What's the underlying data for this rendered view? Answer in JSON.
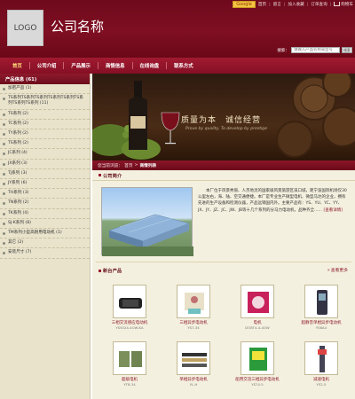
{
  "header": {
    "logo_text": "LOGO",
    "company_name": "公司名称",
    "google_badge": "Google",
    "top_links": [
      "首页",
      "留言",
      "加入收藏",
      "订单查询",
      "购物车"
    ],
    "search": {
      "label": "搜索：",
      "placeholder": "请输入产品名称或型号",
      "button": "搜索"
    }
  },
  "nav": {
    "items": [
      "首页",
      "公司介绍",
      "产品展示",
      "商情信息",
      "在线询盘",
      "联系方式"
    ]
  },
  "sidebar": {
    "title": "产品信息 (61)",
    "items": [
      "加密产品 (1)",
      "TS系列TS系列TS系列TS系列TS系列TS系列TS系列TS系列 (11)",
      "TS系列 (2)",
      "TC系列 (2)",
      "TY系列 (2)",
      "TS系列 (2)",
      "JC系列 (4)",
      "JX系列 (3)",
      "TJ系列 (3)",
      "JY系列 (6)",
      "TH系列 (3)",
      "TN系列 (2)",
      "TK系列 (4)",
      "SJ-K系列 (8)",
      "TM系列小型高耐用电动机 (1)",
      "其它 (2)",
      "安装尺寸 (7)"
    ]
  },
  "banner": {
    "slogan": "质量为本　诚信经营",
    "sub": "Prove by quality, To develop by prestige"
  },
  "breadcrumb": {
    "prefix": "您当前浏览：",
    "home": "首页",
    "sep": ">",
    "current": "商情列表"
  },
  "intro": {
    "title": "公司简介",
    "text": "本厂位于风景秀丽、人杰地灵的国家级风景旅游区溪口城，距宁波国际机场仅30公里左右，海、陆、空交通便捷。本厂是专业生产微型电机、微型马达的企业，拥有先进的生产设备和检测仪器，产品远销国内外。主要产品有：YS、YU、YC、YY、JX、JY、JZ、JC、JW、JB等十几个系列的分马力电动机，品种齐全……",
    "more": "[查看详情]"
  },
  "products_section": {
    "title": "新台产品",
    "more": "查看更多"
  },
  "products": [
    {
      "name": "三相交流感应电动机",
      "model": "YS5024-4OW-KA"
    },
    {
      "name": "三相异步电动机",
      "model": "YS7-34"
    },
    {
      "name": "电机",
      "model": "DO8T4-4-4OW"
    },
    {
      "name": "超静音单相异步电动机",
      "model": "YS6A4"
    },
    {
      "name": "超级电机",
      "model": "YT8-34"
    },
    {
      "name": "单相异步电动机",
      "model": "YL-H"
    },
    {
      "name": "船用交流三相异步电动机",
      "model": "YS74-5"
    },
    {
      "name": "减速电机",
      "model": "YS2-5"
    }
  ],
  "colors": {
    "header_bg": "#7f0f22",
    "nav_bg": "#a11a30",
    "sidebar_bg": "#e9e3cc",
    "main_bg": "#f4f0df",
    "link": "#8a1628"
  },
  "icons": [
    "cart-icon",
    "bullet-icon"
  ]
}
